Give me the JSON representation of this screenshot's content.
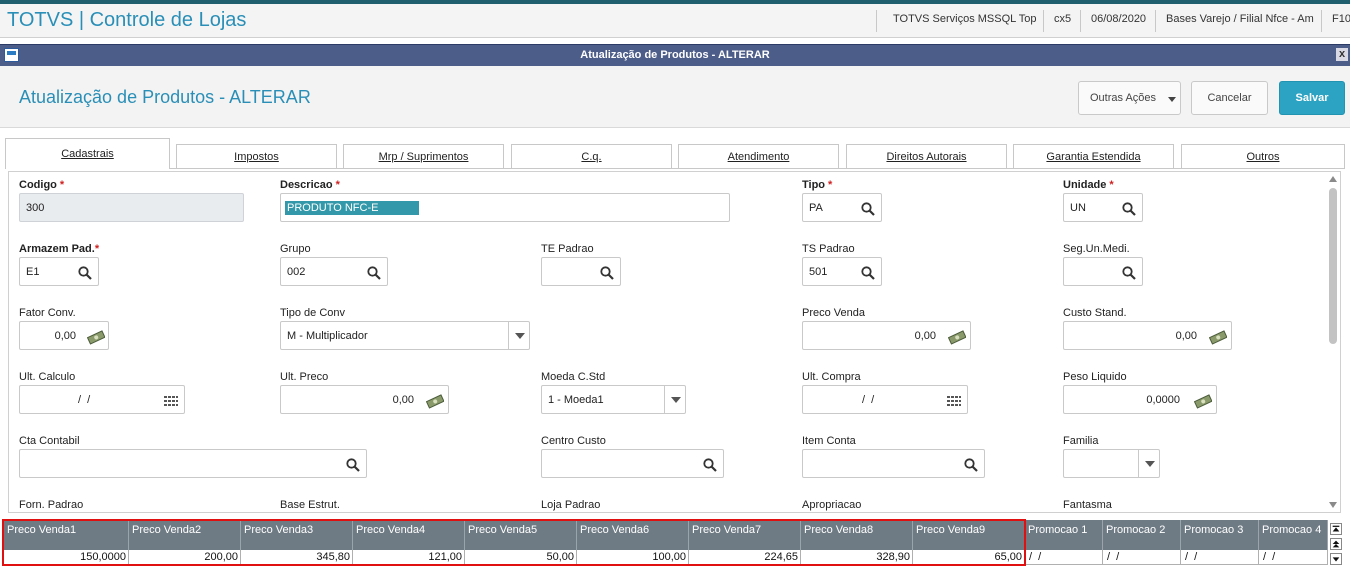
{
  "app": {
    "title": "TOTVS | Controle de Lojas",
    "header_info": [
      "TOTVS Serviços MSSQL Top",
      "cx5",
      "06/08/2020",
      "Bases Varejo / Filial Nfce - Am",
      "F10"
    ]
  },
  "window": {
    "title": "Atualização de Produtos - ALTERAR",
    "close": "x"
  },
  "page": {
    "title": "Atualização de Produtos - ALTERAR",
    "buttons": {
      "outras": "Outras Ações",
      "cancelar": "Cancelar",
      "salvar": "Salvar"
    }
  },
  "tabs": [
    "Cadastrais",
    "Impostos",
    "Mrp / Suprimentos",
    "C.q.",
    "Atendimento",
    "Direitos Autorais",
    "Garantia Estendida",
    "Outros"
  ],
  "form": {
    "codigo": {
      "label": "Codigo",
      "value": "300"
    },
    "descricao": {
      "label": "Descricao",
      "value": "PRODUTO NFC-E"
    },
    "tipo": {
      "label": "Tipo",
      "value": "PA"
    },
    "unidade": {
      "label": "Unidade",
      "value": "UN"
    },
    "armazem": {
      "label": "Armazem Pad.",
      "value": "E1"
    },
    "grupo": {
      "label": "Grupo",
      "value": "002"
    },
    "te_padrao": {
      "label": "TE Padrao",
      "value": ""
    },
    "ts_padrao": {
      "label": "TS Padrao",
      "value": "501"
    },
    "seg_un": {
      "label": "Seg.Un.Medi.",
      "value": ""
    },
    "fator_conv": {
      "label": "Fator Conv.",
      "value": "0,00"
    },
    "tipo_conv": {
      "label": "Tipo de Conv",
      "value": "M - Multiplicador"
    },
    "preco_venda": {
      "label": "Preco Venda",
      "value": "0,00"
    },
    "custo_stand": {
      "label": "Custo Stand.",
      "value": "0,00"
    },
    "ult_calculo": {
      "label": "Ult. Calculo",
      "value": "/  /"
    },
    "ult_preco": {
      "label": "Ult. Preco",
      "value": "0,00"
    },
    "moeda": {
      "label": "Moeda C.Std",
      "value": "1 - Moeda1"
    },
    "ult_compra": {
      "label": "Ult. Compra",
      "value": "/  /"
    },
    "peso_liquido": {
      "label": "Peso Liquido",
      "value": "0,0000"
    },
    "cta_contabil": {
      "label": "Cta Contabil",
      "value": ""
    },
    "centro_custo": {
      "label": "Centro Custo",
      "value": ""
    },
    "item_conta": {
      "label": "Item Conta",
      "value": ""
    },
    "familia": {
      "label": "Familia",
      "value": ""
    },
    "forn_padrao": {
      "label": "Forn. Padrao"
    },
    "base_estrut": {
      "label": "Base Estrut."
    },
    "loja_padrao": {
      "label": "Loja Padrao"
    },
    "apropriacao": {
      "label": "Apropriacao"
    },
    "fantasma": {
      "label": "Fantasma"
    }
  },
  "grid": {
    "headers": [
      "Preco Venda1",
      "Preco Venda2",
      "Preco Venda3",
      "Preco Venda4",
      "Preco Venda5",
      "Preco Venda6",
      "Preco Venda7",
      "Preco Venda8",
      "Preco Venda9",
      "Promocao 1",
      "Promocao 2",
      "Promocao 3",
      "Promocao 4"
    ],
    "row": [
      "150,0000",
      "200,00",
      "345,80",
      "121,00",
      "50,00",
      "100,00",
      "224,65",
      "328,90",
      "65,00",
      "/  /",
      "/  /",
      "/  /",
      "/  /"
    ]
  },
  "colors": {
    "accent": "#2a8fb7",
    "save": "#2da3c3",
    "window_bar": "#4d5d8a",
    "grid_header": "#6f7b84",
    "highlight": "#e01010"
  }
}
